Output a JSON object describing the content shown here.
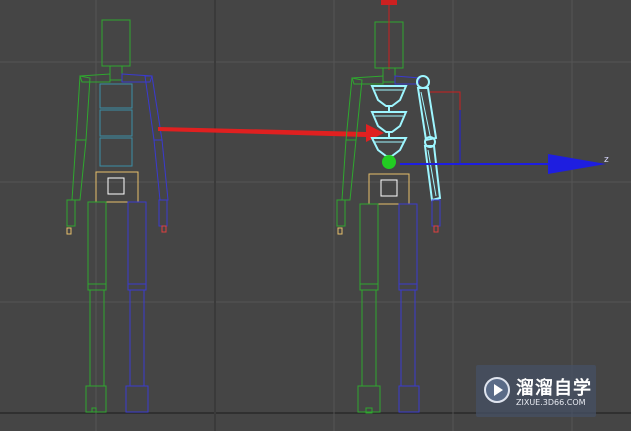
{
  "watermark": {
    "title": "溜溜自学",
    "subtitle": "ZIXUE.3D66.COM"
  },
  "gizmo": {
    "axis_z_label": "z"
  },
  "colors": {
    "viewport_bg": "#454545",
    "grid": "#555555",
    "biped_left": "#2fa82f",
    "biped_right": "#3a3ad0",
    "spine": "#3a8fa6",
    "pelvis": "#e6c06a",
    "selection": "#9ef6ff",
    "arrow": "#e02020",
    "axis_z": "#1e1ee0",
    "axis_x": "#cc2020"
  },
  "icons": {
    "watermark_logo": "play-circle-icon"
  }
}
